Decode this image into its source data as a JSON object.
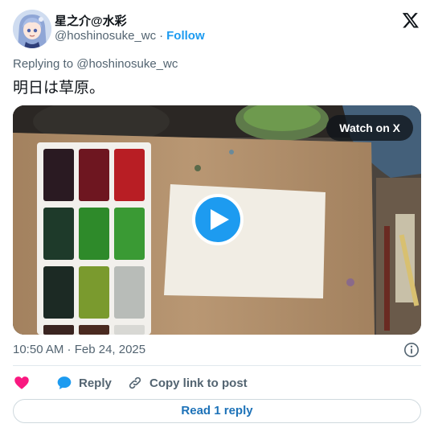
{
  "author": {
    "display_name": "星之介@水彩",
    "handle": "@hoshinosuke_wc",
    "separator": "·",
    "follow_label": "Follow"
  },
  "replying_to": {
    "prefix": "Replying to",
    "mention": "@hoshinosuke_wc"
  },
  "tweet": {
    "text": "明日は草原。"
  },
  "media": {
    "watch_label": "Watch on X"
  },
  "meta": {
    "timestamp": "10:50 AM · Feb 24, 2025"
  },
  "actions": {
    "like_icon": "heart-icon",
    "reply_label": "Reply",
    "copy_label": "Copy link to post"
  },
  "footer": {
    "read_reply_label": "Read 1 reply"
  },
  "colors": {
    "accent": "#1d9bf0",
    "like": "#f91880",
    "muted": "#536471"
  }
}
